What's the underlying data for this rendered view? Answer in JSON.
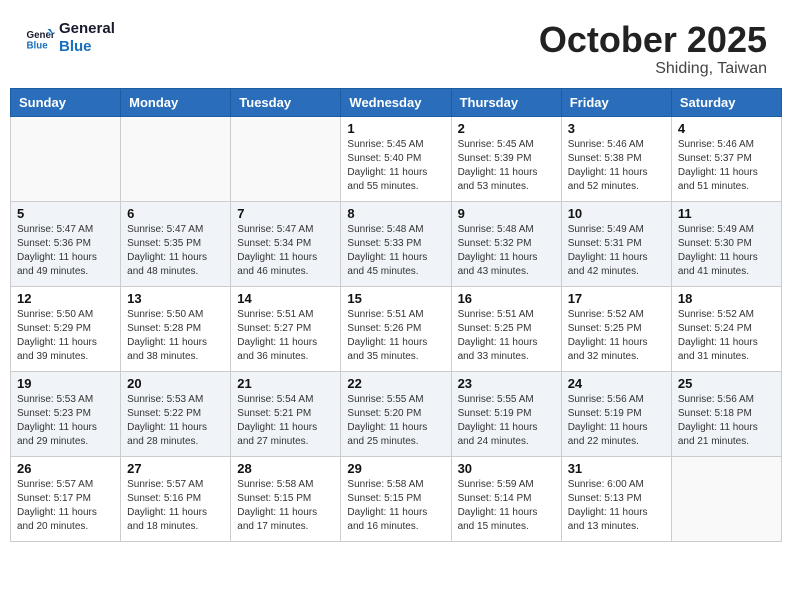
{
  "header": {
    "logo_line1": "General",
    "logo_line2": "Blue",
    "month": "October 2025",
    "location": "Shiding, Taiwan"
  },
  "days_of_week": [
    "Sunday",
    "Monday",
    "Tuesday",
    "Wednesday",
    "Thursday",
    "Friday",
    "Saturday"
  ],
  "weeks": [
    [
      {
        "day": "",
        "info": ""
      },
      {
        "day": "",
        "info": ""
      },
      {
        "day": "",
        "info": ""
      },
      {
        "day": "1",
        "info": "Sunrise: 5:45 AM\nSunset: 5:40 PM\nDaylight: 11 hours\nand 55 minutes."
      },
      {
        "day": "2",
        "info": "Sunrise: 5:45 AM\nSunset: 5:39 PM\nDaylight: 11 hours\nand 53 minutes."
      },
      {
        "day": "3",
        "info": "Sunrise: 5:46 AM\nSunset: 5:38 PM\nDaylight: 11 hours\nand 52 minutes."
      },
      {
        "day": "4",
        "info": "Sunrise: 5:46 AM\nSunset: 5:37 PM\nDaylight: 11 hours\nand 51 minutes."
      }
    ],
    [
      {
        "day": "5",
        "info": "Sunrise: 5:47 AM\nSunset: 5:36 PM\nDaylight: 11 hours\nand 49 minutes."
      },
      {
        "day": "6",
        "info": "Sunrise: 5:47 AM\nSunset: 5:35 PM\nDaylight: 11 hours\nand 48 minutes."
      },
      {
        "day": "7",
        "info": "Sunrise: 5:47 AM\nSunset: 5:34 PM\nDaylight: 11 hours\nand 46 minutes."
      },
      {
        "day": "8",
        "info": "Sunrise: 5:48 AM\nSunset: 5:33 PM\nDaylight: 11 hours\nand 45 minutes."
      },
      {
        "day": "9",
        "info": "Sunrise: 5:48 AM\nSunset: 5:32 PM\nDaylight: 11 hours\nand 43 minutes."
      },
      {
        "day": "10",
        "info": "Sunrise: 5:49 AM\nSunset: 5:31 PM\nDaylight: 11 hours\nand 42 minutes."
      },
      {
        "day": "11",
        "info": "Sunrise: 5:49 AM\nSunset: 5:30 PM\nDaylight: 11 hours\nand 41 minutes."
      }
    ],
    [
      {
        "day": "12",
        "info": "Sunrise: 5:50 AM\nSunset: 5:29 PM\nDaylight: 11 hours\nand 39 minutes."
      },
      {
        "day": "13",
        "info": "Sunrise: 5:50 AM\nSunset: 5:28 PM\nDaylight: 11 hours\nand 38 minutes."
      },
      {
        "day": "14",
        "info": "Sunrise: 5:51 AM\nSunset: 5:27 PM\nDaylight: 11 hours\nand 36 minutes."
      },
      {
        "day": "15",
        "info": "Sunrise: 5:51 AM\nSunset: 5:26 PM\nDaylight: 11 hours\nand 35 minutes."
      },
      {
        "day": "16",
        "info": "Sunrise: 5:51 AM\nSunset: 5:25 PM\nDaylight: 11 hours\nand 33 minutes."
      },
      {
        "day": "17",
        "info": "Sunrise: 5:52 AM\nSunset: 5:25 PM\nDaylight: 11 hours\nand 32 minutes."
      },
      {
        "day": "18",
        "info": "Sunrise: 5:52 AM\nSunset: 5:24 PM\nDaylight: 11 hours\nand 31 minutes."
      }
    ],
    [
      {
        "day": "19",
        "info": "Sunrise: 5:53 AM\nSunset: 5:23 PM\nDaylight: 11 hours\nand 29 minutes."
      },
      {
        "day": "20",
        "info": "Sunrise: 5:53 AM\nSunset: 5:22 PM\nDaylight: 11 hours\nand 28 minutes."
      },
      {
        "day": "21",
        "info": "Sunrise: 5:54 AM\nSunset: 5:21 PM\nDaylight: 11 hours\nand 27 minutes."
      },
      {
        "day": "22",
        "info": "Sunrise: 5:55 AM\nSunset: 5:20 PM\nDaylight: 11 hours\nand 25 minutes."
      },
      {
        "day": "23",
        "info": "Sunrise: 5:55 AM\nSunset: 5:19 PM\nDaylight: 11 hours\nand 24 minutes."
      },
      {
        "day": "24",
        "info": "Sunrise: 5:56 AM\nSunset: 5:19 PM\nDaylight: 11 hours\nand 22 minutes."
      },
      {
        "day": "25",
        "info": "Sunrise: 5:56 AM\nSunset: 5:18 PM\nDaylight: 11 hours\nand 21 minutes."
      }
    ],
    [
      {
        "day": "26",
        "info": "Sunrise: 5:57 AM\nSunset: 5:17 PM\nDaylight: 11 hours\nand 20 minutes."
      },
      {
        "day": "27",
        "info": "Sunrise: 5:57 AM\nSunset: 5:16 PM\nDaylight: 11 hours\nand 18 minutes."
      },
      {
        "day": "28",
        "info": "Sunrise: 5:58 AM\nSunset: 5:15 PM\nDaylight: 11 hours\nand 17 minutes."
      },
      {
        "day": "29",
        "info": "Sunrise: 5:58 AM\nSunset: 5:15 PM\nDaylight: 11 hours\nand 16 minutes."
      },
      {
        "day": "30",
        "info": "Sunrise: 5:59 AM\nSunset: 5:14 PM\nDaylight: 11 hours\nand 15 minutes."
      },
      {
        "day": "31",
        "info": "Sunrise: 6:00 AM\nSunset: 5:13 PM\nDaylight: 11 hours\nand 13 minutes."
      },
      {
        "day": "",
        "info": ""
      }
    ]
  ]
}
